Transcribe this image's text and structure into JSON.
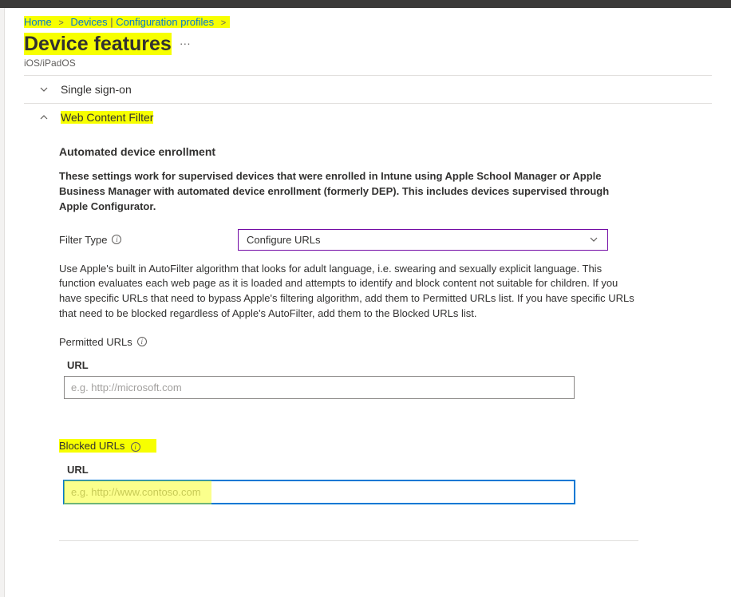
{
  "breadcrumb": {
    "home": "Home",
    "devices": "Devices",
    "config": "Configuration profiles"
  },
  "header": {
    "title": "Device features",
    "subtitle": "iOS/iPadOS"
  },
  "sections": {
    "sso": {
      "label": "Single sign-on"
    },
    "wcf": {
      "label": "Web Content Filter"
    }
  },
  "enrollment": {
    "heading": "Automated device enrollment",
    "text": "These settings work for supervised devices that were enrolled in Intune using Apple School Manager or Apple Business Manager with automated device enrollment (formerly DEP). This includes devices supervised through Apple Configurator."
  },
  "filter": {
    "label": "Filter Type",
    "value": "Configure URLs",
    "desc": "Use Apple's built in AutoFilter algorithm that looks for adult language, i.e. swearing and sexually explicit language. This function evaluates each web page as it is loaded and attempts to identify and block content not suitable for children. If you have specific URLs that need to bypass Apple's filtering algorithm, add them to Permitted URLs list. If you have specific URLs that need to be blocked regardless of Apple's AutoFilter, add them to the Blocked URLs list."
  },
  "permitted": {
    "label": "Permitted URLs",
    "col": "URL",
    "placeholder": "e.g. http://microsoft.com"
  },
  "blocked": {
    "label": "Blocked URLs",
    "col": "URL",
    "placeholder": "e.g. http://www.contoso.com"
  }
}
